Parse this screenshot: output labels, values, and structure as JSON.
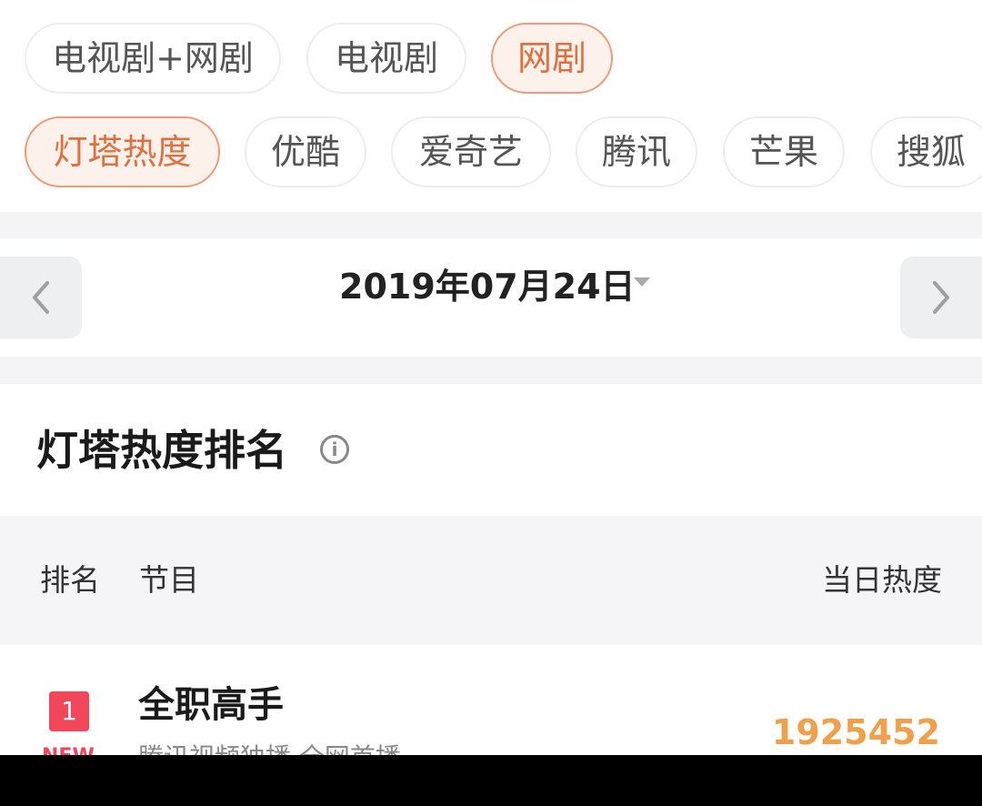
{
  "category_tabs": [
    {
      "label": "电视剧+网剧",
      "active": false
    },
    {
      "label": "电视剧",
      "active": false
    },
    {
      "label": "网剧",
      "active": true
    }
  ],
  "platform_tabs": [
    {
      "label": "灯塔热度",
      "active": true
    },
    {
      "label": "优酷",
      "active": false
    },
    {
      "label": "爱奇艺",
      "active": false
    },
    {
      "label": "腾讯",
      "active": false
    },
    {
      "label": "芒果",
      "active": false
    },
    {
      "label": "搜狐",
      "active": false
    }
  ],
  "date_bar": {
    "date": "2019年07月24日",
    "prev_icon": "chevron-left-icon",
    "next_icon": "chevron-right-icon",
    "dropdown_icon": "caret-down-icon"
  },
  "section": {
    "title": "灯塔热度排名",
    "info_icon": "info-icon"
  },
  "table": {
    "headers": {
      "rank": "排名",
      "show": "节目",
      "heat": "当日热度"
    },
    "rows": [
      {
        "rank": "1",
        "tag": "NEW",
        "title": "全职高手",
        "subtitle": "腾讯视频独播 全网首播",
        "heat": "1925452"
      }
    ]
  },
  "colors": {
    "accent": "#e0703f",
    "rank_badge": "#f2475a",
    "heat_value": "#f0a04a"
  }
}
